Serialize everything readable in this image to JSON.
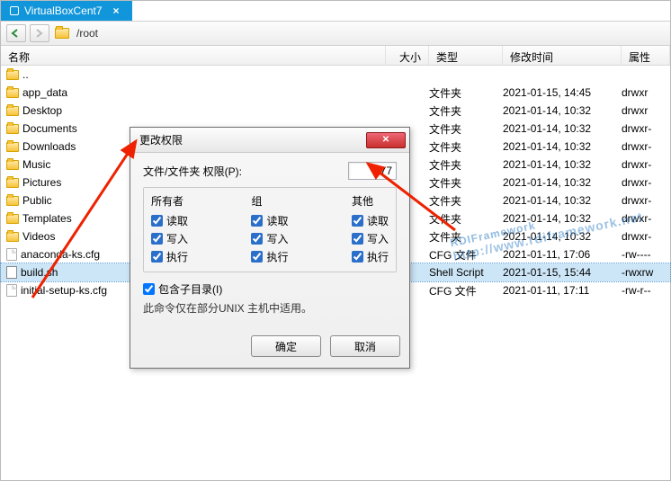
{
  "tab": {
    "title": "VirtualBoxCent7"
  },
  "toolbar": {
    "path": "/root"
  },
  "columns": {
    "name": "名称",
    "size": "大小",
    "type": "类型",
    "modified": "修改时间",
    "attr": "属性"
  },
  "files": [
    {
      "name": "..",
      "icon": "folder",
      "type": "",
      "modified": "",
      "attr": ""
    },
    {
      "name": "app_data",
      "icon": "folder",
      "type": "文件夹",
      "modified": "2021-01-15, 14:45",
      "attr": "drwxr"
    },
    {
      "name": "Desktop",
      "icon": "folder",
      "type": "文件夹",
      "modified": "2021-01-14, 10:32",
      "attr": "drwxr"
    },
    {
      "name": "Documents",
      "icon": "folder",
      "type": "文件夹",
      "modified": "2021-01-14, 10:32",
      "attr": "drwxr-"
    },
    {
      "name": "Downloads",
      "icon": "folder",
      "type": "文件夹",
      "modified": "2021-01-14, 10:32",
      "attr": "drwxr-"
    },
    {
      "name": "Music",
      "icon": "folder",
      "type": "文件夹",
      "modified": "2021-01-14, 10:32",
      "attr": "drwxr-"
    },
    {
      "name": "Pictures",
      "icon": "folder",
      "type": "文件夹",
      "modified": "2021-01-14, 10:32",
      "attr": "drwxr-"
    },
    {
      "name": "Public",
      "icon": "folder",
      "type": "文件夹",
      "modified": "2021-01-14, 10:32",
      "attr": "drwxr-"
    },
    {
      "name": "Templates",
      "icon": "folder",
      "type": "文件夹",
      "modified": "2021-01-14, 10:32",
      "attr": "drwxr-"
    },
    {
      "name": "Videos",
      "icon": "folder",
      "type": "文件夹",
      "modified": "2021-01-14, 10:32",
      "attr": "drwxr-"
    },
    {
      "name": "anaconda-ks.cfg",
      "icon": "file",
      "type": "CFG 文件",
      "modified": "2021-01-11, 17:06",
      "attr": "-rw----"
    },
    {
      "name": "build.sh",
      "icon": "sh",
      "type": "Shell Script",
      "modified": "2021-01-15, 15:44",
      "attr": "-rwxrw",
      "selected": true
    },
    {
      "name": "initial-setup-ks.cfg",
      "icon": "file",
      "type": "CFG 文件",
      "modified": "2021-01-11, 17:11",
      "attr": "-rw-r--"
    }
  ],
  "dialog": {
    "title": "更改权限",
    "perm_label": "文件/文件夹 权限(P):",
    "perm_value": "777",
    "groups": {
      "owner": "所有者",
      "group": "组",
      "other": "其他",
      "read": "读取",
      "write": "写入",
      "execute": "执行"
    },
    "include_subdir": "包含子目录(I)",
    "note": "此命令仅在部分UNIX 主机中适用。",
    "ok": "确定",
    "cancel": "取消"
  },
  "watermark": {
    "line1": "RDIFramework",
    "line2": "http://www.rdiframework.net"
  }
}
